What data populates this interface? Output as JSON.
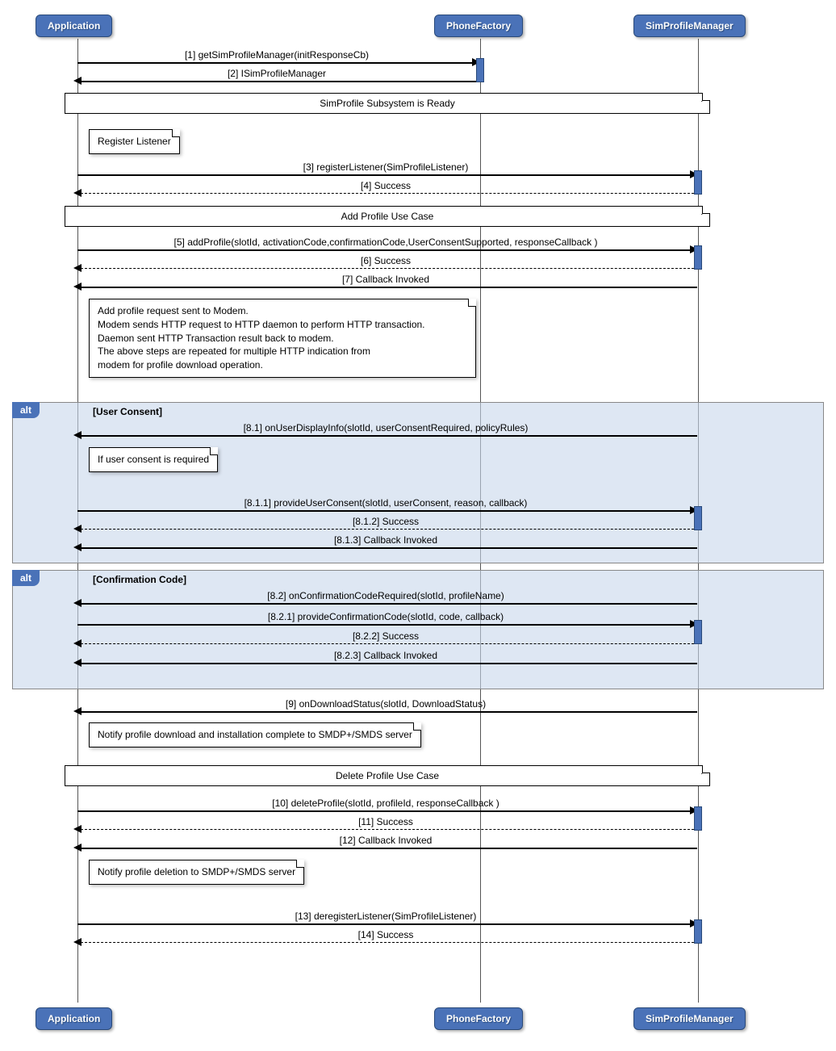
{
  "participants": {
    "application": "Application",
    "phoneFactory": "PhoneFactory",
    "simProfileManager": "SimProfileManager"
  },
  "messages": {
    "m1": "[1] getSimProfileManager(initResponseCb)",
    "m2": "[2] ISimProfileManager",
    "m3": "[3] registerListener(SimProfileListener)",
    "m4": "[4] Success",
    "m5": "[5] addProfile(slotId, activationCode,confirmationCode,UserConsentSupported, responseCallback )",
    "m6": "[6] Success",
    "m7": "[7] Callback Invoked",
    "m81": "[8.1] onUserDisplayInfo(slotId, userConsentRequired, policyRules)",
    "m811": "[8.1.1] provideUserConsent(slotId, userConsent, reason, callback)",
    "m812": "[8.1.2] Success",
    "m813": "[8.1.3] Callback Invoked",
    "m82": "[8.2] onConfirmationCodeRequired(slotId, profileName)",
    "m821": "[8.2.1] provideConfirmationCode(slotId, code, callback)",
    "m822": "[8.2.2] Success",
    "m823": "[8.2.3] Callback Invoked",
    "m9": "[9] onDownloadStatus(slotId, DownloadStatus)",
    "m10": "[10] deleteProfile(slotId, profileId, responseCallback )",
    "m11": "[11] Success",
    "m12": "[12] Callback Invoked",
    "m13": "[13] deregisterListener(SimProfileListener)",
    "m14": "[14] Success"
  },
  "dividers": {
    "d1": "SimProfile Subsystem is Ready",
    "d2": "Add Profile Use Case",
    "d3": "Delete Profile Use Case"
  },
  "notes": {
    "n1": "Register Listener",
    "n2_l1": "Add profile request sent to Modem.",
    "n2_l2": "Modem sends HTTP request to HTTP daemon to perform HTTP transaction.",
    "n2_l3": "Daemon sent HTTP Transaction result back to modem.",
    "n2_l4": "The above steps are repeated for multiple HTTP indication from",
    "n2_l5": "modem for profile download operation.",
    "n3": "If user consent is required",
    "n4": "Notify profile download and installation complete to SMDP+/SMDS server",
    "n5": "Notify profile deletion to SMDP+/SMDS server"
  },
  "alt": {
    "tag": "alt",
    "label1": "[User Consent]",
    "label2": "[Confirmation Code]"
  },
  "chart_data": {
    "type": "sequence",
    "participants": [
      "Application",
      "PhoneFactory",
      "SimProfileManager"
    ],
    "interactions": [
      {
        "num": "1",
        "from": "Application",
        "to": "PhoneFactory",
        "label": "getSimProfileManager(initResponseCb)",
        "kind": "sync"
      },
      {
        "num": "2",
        "from": "PhoneFactory",
        "to": "Application",
        "label": "ISimProfileManager",
        "kind": "return"
      },
      {
        "divider": "SimProfile Subsystem is Ready"
      },
      {
        "note": "Register Listener",
        "over": "Application"
      },
      {
        "num": "3",
        "from": "Application",
        "to": "SimProfileManager",
        "label": "registerListener(SimProfileListener)",
        "kind": "sync"
      },
      {
        "num": "4",
        "from": "SimProfileManager",
        "to": "Application",
        "label": "Success",
        "kind": "return-dashed"
      },
      {
        "divider": "Add Profile Use Case"
      },
      {
        "num": "5",
        "from": "Application",
        "to": "SimProfileManager",
        "label": "addProfile(slotId, activationCode,confirmationCode,UserConsentSupported, responseCallback )",
        "kind": "sync"
      },
      {
        "num": "6",
        "from": "SimProfileManager",
        "to": "Application",
        "label": "Success",
        "kind": "return-dashed"
      },
      {
        "num": "7",
        "from": "SimProfileManager",
        "to": "Application",
        "label": "Callback Invoked",
        "kind": "return"
      },
      {
        "note": "Add profile request sent to Modem. Modem sends HTTP request to HTTP daemon to perform HTTP transaction. Daemon sent HTTP Transaction result back to modem. The above steps are repeated for multiple HTTP indication from modem for profile download operation.",
        "over": "Application"
      },
      {
        "alt": "User Consent",
        "interactions": [
          {
            "num": "8.1",
            "from": "SimProfileManager",
            "to": "Application",
            "label": "onUserDisplayInfo(slotId, userConsentRequired, policyRules)",
            "kind": "return"
          },
          {
            "note": "If user consent is required",
            "over": "Application"
          },
          {
            "num": "8.1.1",
            "from": "Application",
            "to": "SimProfileManager",
            "label": "provideUserConsent(slotId, userConsent, reason, callback)",
            "kind": "sync"
          },
          {
            "num": "8.1.2",
            "from": "SimProfileManager",
            "to": "Application",
            "label": "Success",
            "kind": "return-dashed"
          },
          {
            "num": "8.1.3",
            "from": "SimProfileManager",
            "to": "Application",
            "label": "Callback Invoked",
            "kind": "return"
          }
        ]
      },
      {
        "alt": "Confirmation Code",
        "interactions": [
          {
            "num": "8.2",
            "from": "SimProfileManager",
            "to": "Application",
            "label": "onConfirmationCodeRequired(slotId, profileName)",
            "kind": "return"
          },
          {
            "num": "8.2.1",
            "from": "Application",
            "to": "SimProfileManager",
            "label": "provideConfirmationCode(slotId, code, callback)",
            "kind": "sync"
          },
          {
            "num": "8.2.2",
            "from": "SimProfileManager",
            "to": "Application",
            "label": "Success",
            "kind": "return-dashed"
          },
          {
            "num": "8.2.3",
            "from": "SimProfileManager",
            "to": "Application",
            "label": "Callback Invoked",
            "kind": "return"
          }
        ]
      },
      {
        "num": "9",
        "from": "SimProfileManager",
        "to": "Application",
        "label": "onDownloadStatus(slotId, DownloadStatus)",
        "kind": "return"
      },
      {
        "note": "Notify profile download and installation complete to SMDP+/SMDS server",
        "over": "Application"
      },
      {
        "divider": "Delete Profile Use Case"
      },
      {
        "num": "10",
        "from": "Application",
        "to": "SimProfileManager",
        "label": "deleteProfile(slotId, profileId, responseCallback )",
        "kind": "sync"
      },
      {
        "num": "11",
        "from": "SimProfileManager",
        "to": "Application",
        "label": "Success",
        "kind": "return-dashed"
      },
      {
        "num": "12",
        "from": "SimProfileManager",
        "to": "Application",
        "label": "Callback Invoked",
        "kind": "return"
      },
      {
        "note": "Notify profile deletion to SMDP+/SMDS server",
        "over": "Application"
      },
      {
        "num": "13",
        "from": "Application",
        "to": "SimProfileManager",
        "label": "deregisterListener(SimProfileListener)",
        "kind": "sync"
      },
      {
        "num": "14",
        "from": "SimProfileManager",
        "to": "Application",
        "label": "Success",
        "kind": "return-dashed"
      }
    ]
  }
}
